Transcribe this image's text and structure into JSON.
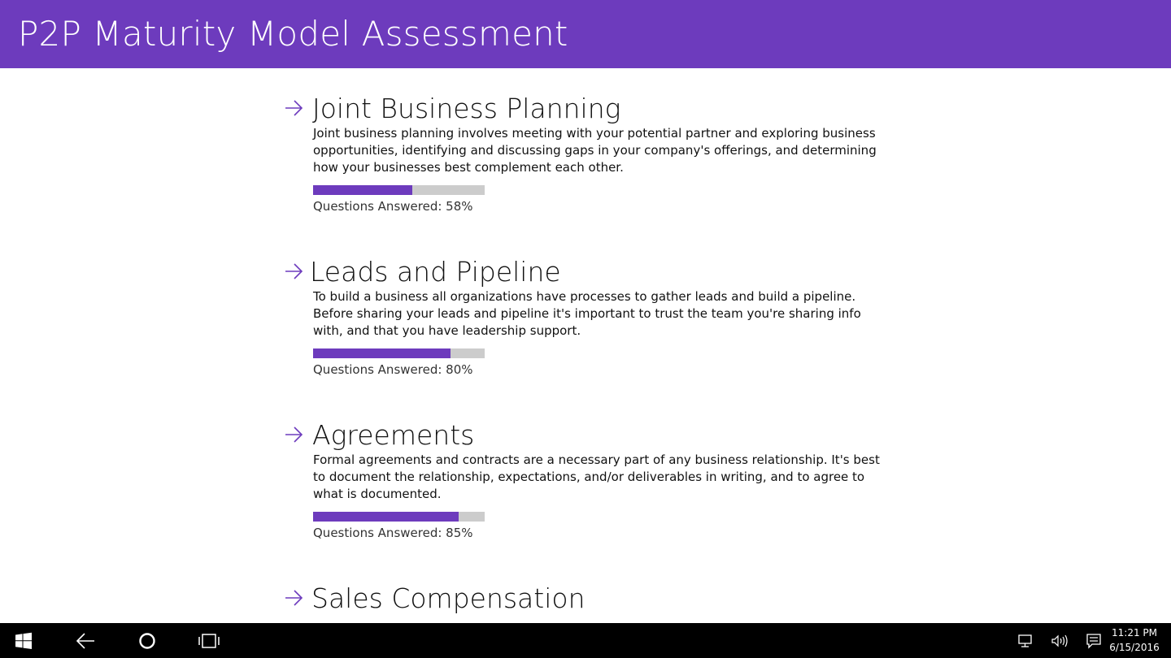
{
  "app": {
    "title": "P2P Maturity Model Assessment",
    "accent_color": "#6d3bbd"
  },
  "sections": [
    {
      "title": "Joint Business Planning",
      "description": "Joint business planning involves meeting with your potential partner and exploring business opportunities, identifying and discussing gaps in your company's offerings, and determining how your businesses best complement each other.",
      "progress_label": "Questions Answered: 58%",
      "progress": 0.58,
      "icon": "arrow-right-icon"
    },
    {
      "title": "Leads and Pipeline",
      "description": "To build a business all organizations have processes to gather leads and build a pipeline. Before sharing your leads and pipeline it's important to trust the team you're sharing info with, and that you have leadership support.",
      "progress_label": "Questions Answered: 80%",
      "progress": 0.8,
      "icon": "arrow-right-icon"
    },
    {
      "title": "Agreements",
      "description": "Formal agreements and contracts are a necessary part of any business relationship. It's best to document the relationship, expectations, and/or deliverables in writing, and to agree to what is documented.",
      "progress_label": "Questions Answered: 85%",
      "progress": 0.85,
      "icon": "arrow-right-icon"
    },
    {
      "title": "Sales Compensation",
      "icon": "arrow-right-icon"
    }
  ],
  "taskbar": {
    "icons": [
      "windows-start-icon",
      "back-arrow-icon",
      "cortana-circle-icon",
      "task-view-icon",
      "network-icon",
      "volume-icon",
      "action-center-icon"
    ],
    "time": "11:21 PM",
    "date": "6/15/2016"
  }
}
